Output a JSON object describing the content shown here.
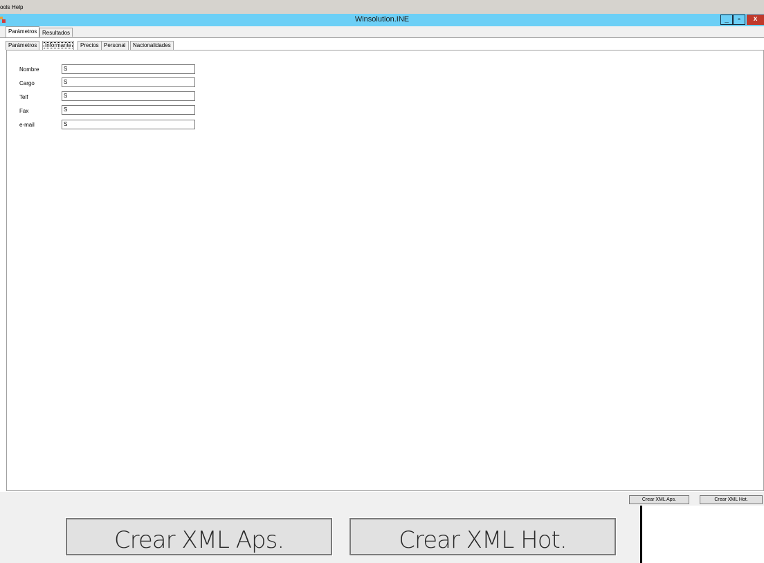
{
  "menubar": {
    "items": [
      "ools",
      "Help"
    ]
  },
  "window": {
    "title": "Winsolution.INE",
    "minimize": "_",
    "maximize": "▫",
    "close": "x"
  },
  "outer_tabs": [
    "Parámetros",
    "Resultados"
  ],
  "inner_tabs": [
    "Parámetros",
    "Informante",
    "Precios",
    "Personal",
    "Nacionalidades"
  ],
  "form": {
    "fields": [
      {
        "label": "Nombre",
        "value": "S"
      },
      {
        "label": "Cargo",
        "value": "S"
      },
      {
        "label": "Telf",
        "value": "S"
      },
      {
        "label": "Fax",
        "value": "S"
      },
      {
        "label": "e-mail",
        "value": "S"
      }
    ]
  },
  "small_buttons": [
    "Crear XML Aps.",
    "Crear XML Hot."
  ],
  "big_buttons": [
    "Crear XML Aps.",
    "Crear XML Hot."
  ],
  "colors": {
    "titlebar": "#6ccff6",
    "close": "#c0392b",
    "menubar": "#d6d3ce"
  }
}
